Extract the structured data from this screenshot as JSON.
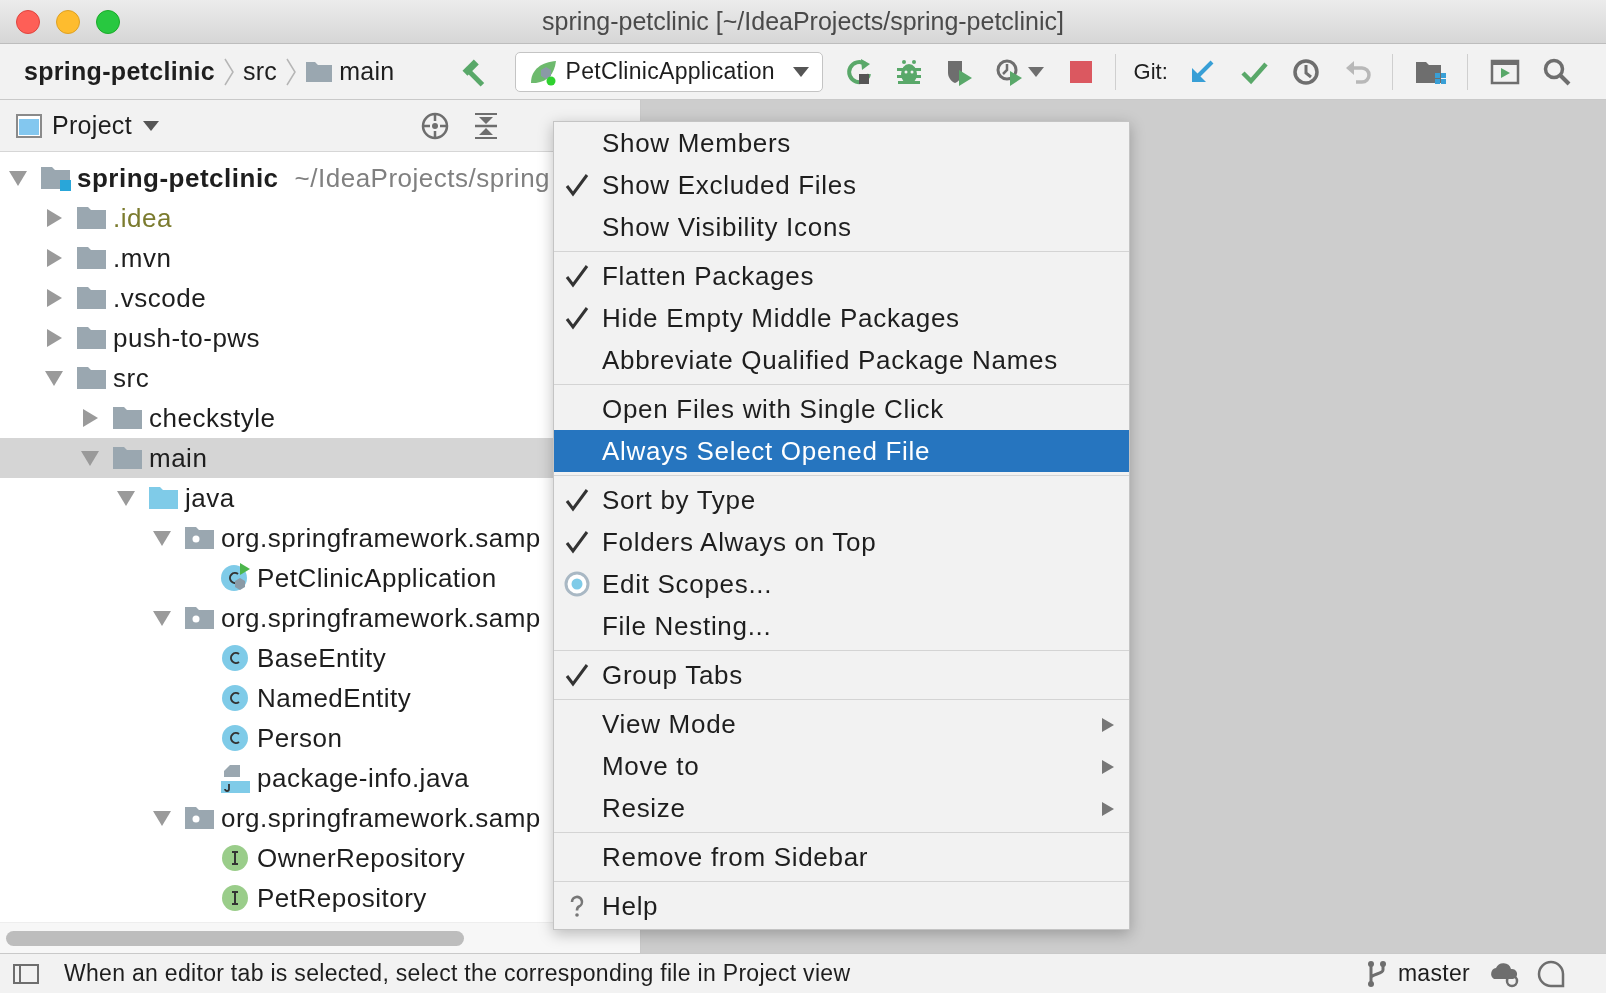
{
  "window": {
    "title": "spring-petclinic [~/IdeaProjects/spring-petclinic]"
  },
  "breadcrumbs": [
    {
      "label": "spring-petclinic",
      "kind": "project"
    },
    {
      "label": "src",
      "kind": "plain"
    },
    {
      "label": "main",
      "kind": "folder"
    }
  ],
  "toolbar": {
    "run_configuration": "PetClinicApplication",
    "git_label": "Git:"
  },
  "project_panel": {
    "view_label": "Project",
    "tree": [
      {
        "label": "spring-petclinic",
        "kind": "module",
        "path": "~/IdeaProjects/spring",
        "expanded": true,
        "selected": false,
        "ignored": false,
        "children": [
          {
            "label": ".idea",
            "kind": "folder",
            "expanded": false,
            "selected": false,
            "ignored": true
          },
          {
            "label": ".mvn",
            "kind": "folder",
            "expanded": false,
            "selected": false,
            "ignored": false
          },
          {
            "label": ".vscode",
            "kind": "folder",
            "expanded": false,
            "selected": false,
            "ignored": false
          },
          {
            "label": "push-to-pws",
            "kind": "folder",
            "expanded": false,
            "selected": false,
            "ignored": false
          },
          {
            "label": "src",
            "kind": "folder",
            "expanded": true,
            "selected": false,
            "ignored": false,
            "children": [
              {
                "label": "checkstyle",
                "kind": "folder",
                "expanded": false,
                "selected": false,
                "ignored": false
              },
              {
                "label": "main",
                "kind": "folder",
                "expanded": true,
                "selected": true,
                "ignored": false,
                "children": [
                  {
                    "label": "java",
                    "kind": "source_folder",
                    "expanded": true,
                    "selected": false,
                    "ignored": false,
                    "children": [
                      {
                        "label": "org.springframework.samp",
                        "kind": "package",
                        "expanded": true,
                        "selected": false,
                        "ignored": false,
                        "children": [
                          {
                            "label": "PetClinicApplication",
                            "kind": "spring_class",
                            "selected": false,
                            "ignored": false
                          }
                        ]
                      },
                      {
                        "label": "org.springframework.samp",
                        "kind": "package",
                        "expanded": true,
                        "selected": false,
                        "ignored": false,
                        "children": [
                          {
                            "label": "BaseEntity",
                            "kind": "class",
                            "selected": false,
                            "ignored": false
                          },
                          {
                            "label": "NamedEntity",
                            "kind": "class",
                            "selected": false,
                            "ignored": false
                          },
                          {
                            "label": "Person",
                            "kind": "class",
                            "selected": false,
                            "ignored": false
                          },
                          {
                            "label": "package-info.java",
                            "kind": "java_file",
                            "selected": false,
                            "ignored": false
                          }
                        ]
                      },
                      {
                        "label": "org.springframework.samp",
                        "kind": "package",
                        "expanded": true,
                        "selected": false,
                        "ignored": false,
                        "children": [
                          {
                            "label": "OwnerRepository",
                            "kind": "interface",
                            "selected": false,
                            "ignored": false
                          },
                          {
                            "label": "PetRepository",
                            "kind": "interface",
                            "selected": false,
                            "ignored": false
                          }
                        ]
                      }
                    ]
                  }
                ]
              }
            ]
          }
        ]
      }
    ]
  },
  "popup_menu": {
    "groups": [
      [
        {
          "label": "Show Members",
          "kind": "check",
          "checked": false,
          "selected": false
        },
        {
          "label": "Show Excluded Files",
          "kind": "check",
          "checked": true,
          "selected": false
        },
        {
          "label": "Show Visibility Icons",
          "kind": "check",
          "checked": false,
          "selected": false
        }
      ],
      [
        {
          "label": "Flatten Packages",
          "kind": "check",
          "checked": true,
          "selected": false
        },
        {
          "label": "Hide Empty Middle Packages",
          "kind": "check",
          "checked": true,
          "selected": false
        },
        {
          "label": "Abbreviate Qualified Package Names",
          "kind": "check",
          "checked": false,
          "selected": false
        }
      ],
      [
        {
          "label": "Open Files with Single Click",
          "kind": "check",
          "checked": false,
          "selected": false
        },
        {
          "label": "Always Select Opened File",
          "kind": "check",
          "checked": false,
          "selected": true
        }
      ],
      [
        {
          "label": "Sort by Type",
          "kind": "check",
          "checked": true,
          "selected": false
        },
        {
          "label": "Folders Always on Top",
          "kind": "check",
          "checked": true,
          "selected": false
        },
        {
          "label": "Edit Scopes...",
          "kind": "radio",
          "checked": true,
          "selected": false
        },
        {
          "label": "File Nesting...",
          "kind": "check",
          "checked": false,
          "selected": false
        }
      ],
      [
        {
          "label": "Group Tabs",
          "kind": "check",
          "checked": true,
          "selected": false
        }
      ],
      [
        {
          "label": "View Mode",
          "kind": "submenu",
          "selected": false
        },
        {
          "label": "Move to",
          "kind": "submenu",
          "selected": false
        },
        {
          "label": "Resize",
          "kind": "submenu",
          "selected": false
        }
      ],
      [
        {
          "label": "Remove from Sidebar",
          "kind": "check",
          "checked": false,
          "selected": false
        }
      ],
      [
        {
          "label": "Help",
          "kind": "help",
          "selected": false
        }
      ]
    ]
  },
  "status_bar": {
    "message": "When an editor tab is selected, select the corresponding file in Project view",
    "branch": "master"
  }
}
